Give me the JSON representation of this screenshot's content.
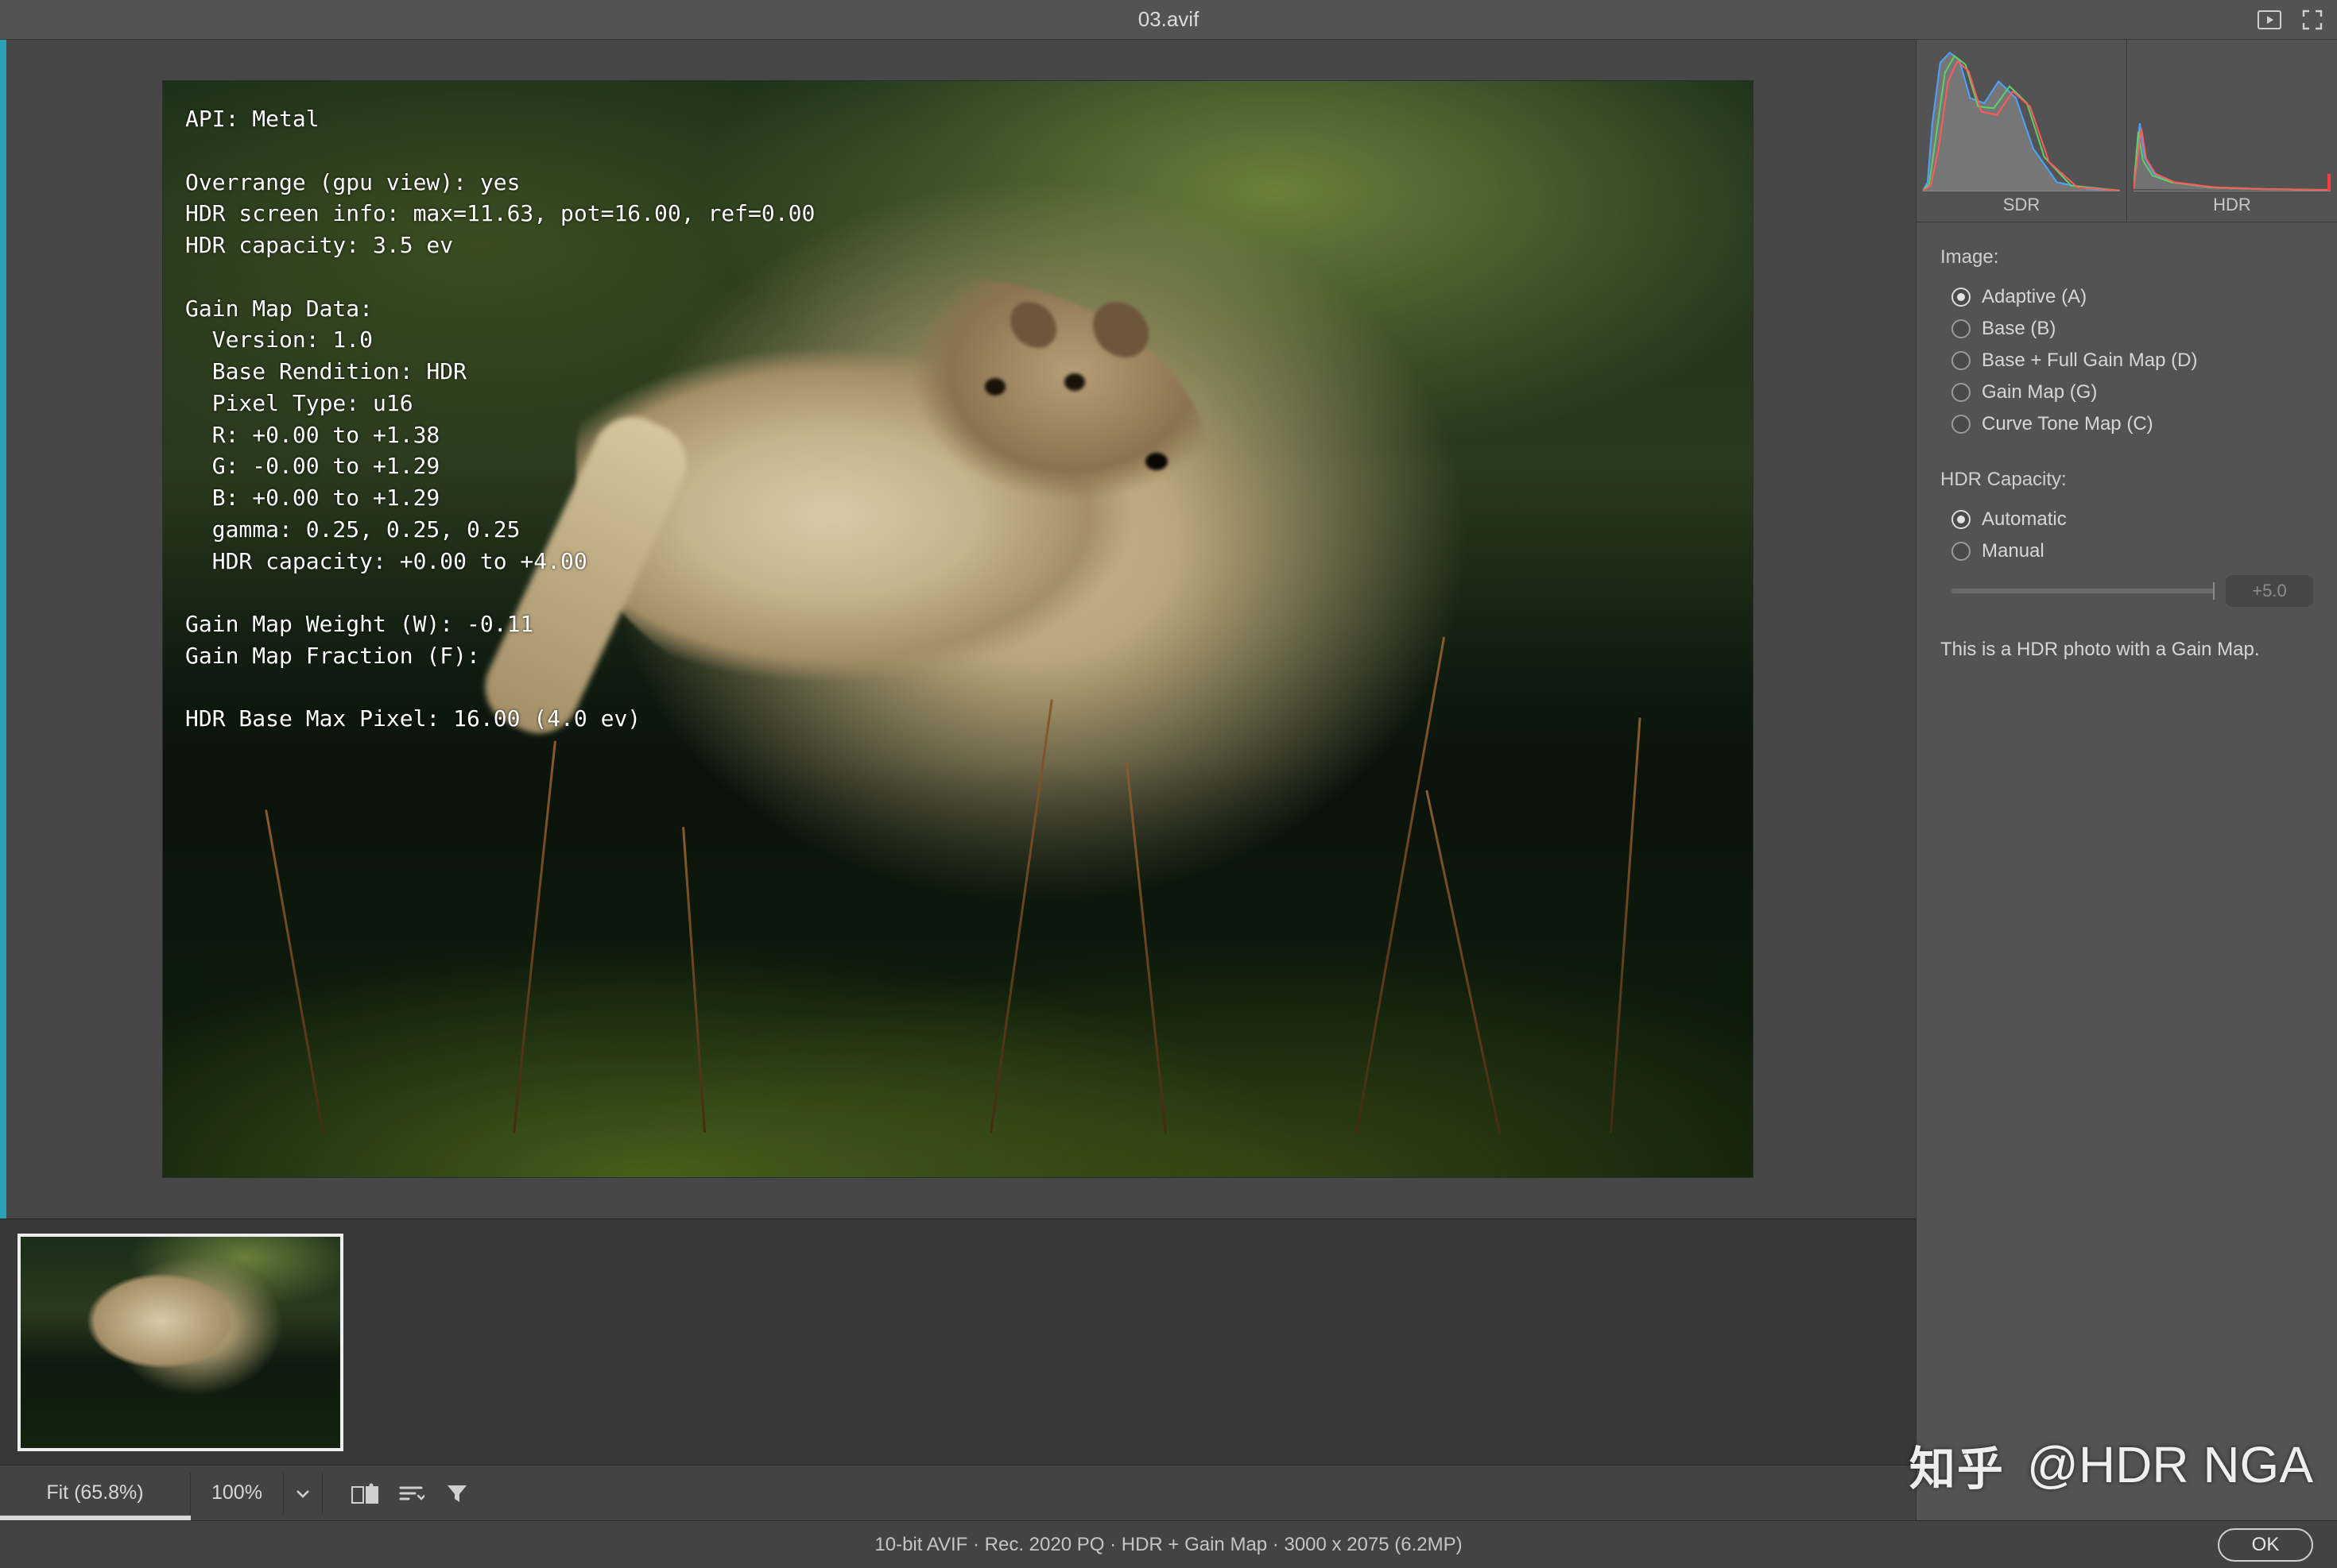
{
  "title": "03.avif",
  "overlay": {
    "api_line": "API: Metal",
    "overrange": "Overrange (gpu view): yes",
    "hdr_screen": "HDR screen info: max=11.63, pot=16.00, ref=0.00",
    "hdr_cap": "HDR capacity: 3.5 ev",
    "gain_head": "Gain Map Data:",
    "version": "  Version: 1.0",
    "base_rend": "  Base Rendition: HDR",
    "pxtype": "  Pixel Type: u16",
    "r": "  R: +0.00 to +1.38",
    "g": "  G: -0.00 to +1.29",
    "b": "  B: +0.00 to +1.29",
    "gamma": "  gamma: 0.25, 0.25, 0.25",
    "hdr_cap2": "  HDR capacity: +0.00 to +4.00",
    "gmw": "Gain Map Weight (W): -0.11",
    "gmf": "Gain Map Fraction (F):",
    "hdr_max": "HDR Base Max Pixel: 16.00 (4.0 ev)"
  },
  "bottom": {
    "fit": "Fit (65.8%)",
    "hundred": "100%"
  },
  "side": {
    "histo_sdr": "SDR",
    "histo_hdr": "HDR",
    "image_head": "Image:",
    "image_opts": [
      "Adaptive (A)",
      "Base (B)",
      "Base + Full Gain Map (D)",
      "Gain Map (G)",
      "Curve Tone Map (C)"
    ],
    "image_sel": 0,
    "hdr_head": "HDR Capacity:",
    "hdr_opts": [
      "Automatic",
      "Manual"
    ],
    "hdr_sel": 0,
    "slider_val": "+5.0",
    "info": "This is a HDR photo with a Gain Map."
  },
  "status": {
    "center": "10-bit AVIF  ·  Rec. 2020 PQ  ·  HDR + Gain Map  ·  3000 x 2075 (6.2MP)",
    "ok": "OK"
  },
  "watermark": {
    "zh": "知乎",
    "rest": "@HDR NGA"
  }
}
